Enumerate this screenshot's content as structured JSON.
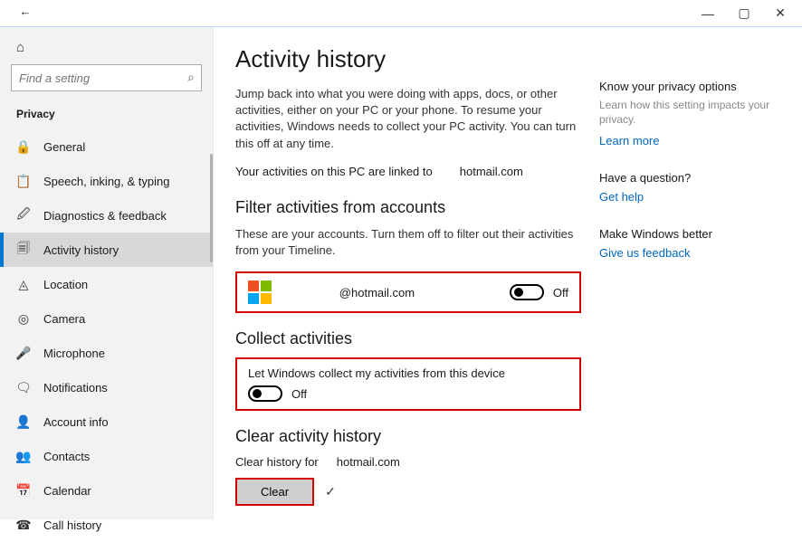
{
  "window": {
    "minimize": "—",
    "maximize": "▢",
    "close": "✕"
  },
  "sidebar": {
    "back_icon": "←",
    "home_icon": "⌂",
    "search_placeholder": "Find a setting",
    "search_icon": "⌕",
    "title": "Privacy",
    "items": [
      {
        "icon": "🔒",
        "label": "General"
      },
      {
        "icon": "📋",
        "label": "Speech, inking, & typing"
      },
      {
        "icon": "🖉",
        "label": "Diagnostics & feedback"
      },
      {
        "icon": "🗐",
        "label": "Activity history"
      },
      {
        "icon": "◬",
        "label": "Location"
      },
      {
        "icon": "◎",
        "label": "Camera"
      },
      {
        "icon": "🎤",
        "label": "Microphone"
      },
      {
        "icon": "🗨",
        "label": "Notifications"
      },
      {
        "icon": "👤",
        "label": "Account info"
      },
      {
        "icon": "👥",
        "label": "Contacts"
      },
      {
        "icon": "📅",
        "label": "Calendar"
      },
      {
        "icon": "☎",
        "label": "Call history"
      }
    ],
    "selected_index": 3
  },
  "main": {
    "page_title": "Activity history",
    "intro": "Jump back into what you were doing with apps, docs, or other activities, either on your PC or your phone. To resume your activities, Windows needs to collect your PC activity. You can turn this off at any time.",
    "linked_prefix": "Your activities on this PC are linked to",
    "linked_account": "hotmail.com",
    "filter": {
      "heading": "Filter activities from accounts",
      "desc": "These are your accounts. Turn them off to filter out their activities from your Timeline.",
      "account_email": "@hotmail.com",
      "toggle_state": "Off"
    },
    "collect": {
      "heading": "Collect activities",
      "desc": "Let Windows collect my activities from this device",
      "toggle_state": "Off"
    },
    "clear": {
      "heading": "Clear activity history",
      "prefix": "Clear history for",
      "account": "hotmail.com",
      "button": "Clear",
      "check": "✓"
    }
  },
  "side_panel": {
    "privacy_title": "Know your privacy options",
    "privacy_sub": "Learn how this setting impacts your privacy.",
    "learn_more": "Learn more",
    "question_title": "Have a question?",
    "get_help": "Get help",
    "better_title": "Make Windows better",
    "feedback": "Give us feedback"
  }
}
